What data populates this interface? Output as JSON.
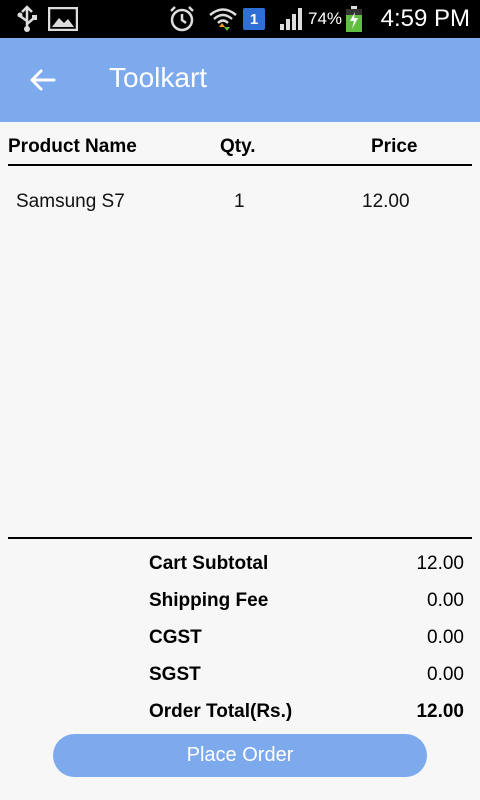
{
  "status_bar": {
    "time": "4:59 PM",
    "battery_percent": "74%",
    "sim_label": "1",
    "icons": [
      "usb-icon",
      "image-icon",
      "alarm-icon",
      "wifi-icon",
      "sim-icon",
      "signal-icon",
      "battery-charging-icon"
    ]
  },
  "app_bar": {
    "title": "Toolkart",
    "back_icon": "arrow-left-icon",
    "color": "#7daaed"
  },
  "table": {
    "headers": {
      "name": "Product Name",
      "qty": "Qty.",
      "price": "Price"
    },
    "rows": [
      {
        "name": "Samsung S7",
        "qty": "1",
        "price": "12.00"
      }
    ]
  },
  "summary": {
    "subtotal_label": "Cart Subtotal",
    "subtotal_value": "12.00",
    "shipping_label": "Shipping Fee",
    "shipping_value": "0.00",
    "cgst_label": "CGST",
    "cgst_value": "0.00",
    "sgst_label": "SGST",
    "sgst_value": "0.00",
    "total_label": "Order Total(Rs.)",
    "total_value": "12.00"
  },
  "actions": {
    "place_order_label": "Place Order"
  }
}
